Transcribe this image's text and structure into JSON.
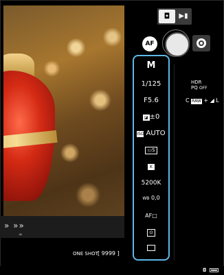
{
  "mode_toggle": {
    "photo_icon": "camera-icon",
    "video_icon": "video-icon",
    "photo_glyph": "◘",
    "video_glyph": "▶▮"
  },
  "top_controls": {
    "af_label": "AF",
    "shutter_icon": "shutter-button",
    "switch_icon": "switch-camera-icon"
  },
  "settings_panel": {
    "accent": "#5fb8e8",
    "shooting_mode": "M",
    "shutter_speed": "1/125",
    "aperture": "F5.6",
    "exposure_comp": "±0",
    "iso": "AUTO",
    "picture_style_icon": "picture-style-icon",
    "picture_style": "S",
    "quality_icon": "quality-icon",
    "quality": "K",
    "white_balance": "5200K",
    "wb_shift_label": "WB",
    "wb_shift": "0,0",
    "af_mode": "AF□",
    "metering_icon": "metering-icon",
    "drive_icon": "drive-mode-icon"
  },
  "right_info": {
    "hdr_line1": "HDR",
    "hdr_line2": "PQ",
    "hdr_state": "OFF",
    "quality_prefix": "C",
    "raw_label": "RAW",
    "quality_suffix": "+ ◢ L"
  },
  "liveview": {
    "af_arrows": "» »»",
    "af_dot": "∞"
  },
  "bottom": {
    "af_operation": "ONE SHOT",
    "shots_remaining": "[ 9999 ]"
  },
  "status": {
    "camera_icon": "camera-icon",
    "battery_icon": "battery-icon"
  }
}
